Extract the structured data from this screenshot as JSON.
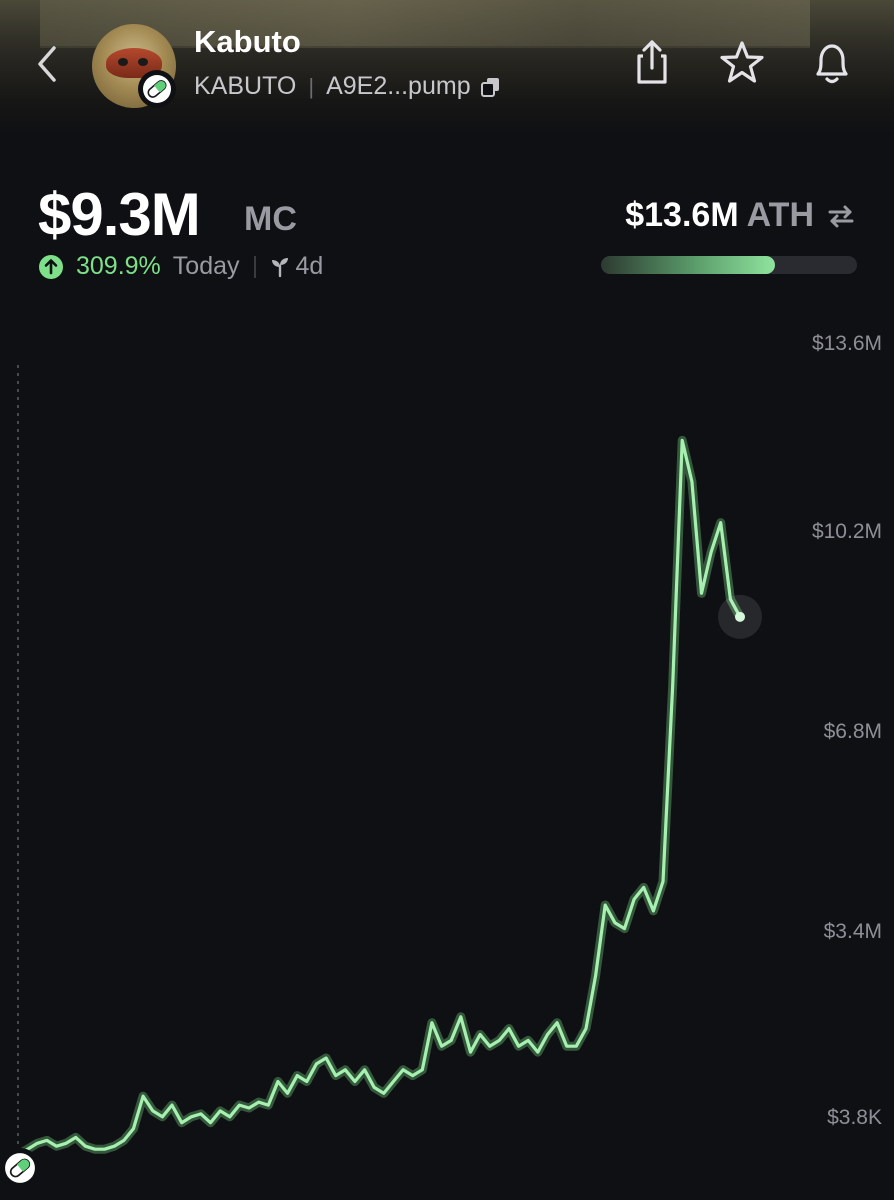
{
  "header": {
    "token_name": "Kabuto",
    "ticker": "KABUTO",
    "separator": "|",
    "address": "A9E2...pump",
    "icons": [
      "back-icon",
      "share-icon",
      "star-icon",
      "bell-icon",
      "copy-icon",
      "pill-icon"
    ]
  },
  "stats": {
    "market_cap": "$9.3M",
    "market_cap_unit": "MC",
    "change_pct": "309.9%",
    "change_period": "Today",
    "age": "4d",
    "ath_value": "$13.6M",
    "ath_label": "ATH",
    "ath_progress": 0.68
  },
  "colors": {
    "background": "#0f1014",
    "accent_green": "#7ee088",
    "muted_text": "#9a9aa2"
  },
  "chart_data": {
    "type": "line",
    "y_ticks": [
      "$13.6M",
      "$10.2M",
      "$6.8M",
      "$3.4M",
      "$3.8K"
    ],
    "ylim": [
      0,
      13.6
    ],
    "y_unit": "$M",
    "x": [
      0,
      1,
      2,
      3,
      4,
      5,
      6,
      7,
      8,
      9,
      10,
      11,
      12,
      13,
      14,
      15,
      16,
      17,
      18,
      19,
      20,
      21,
      22,
      23,
      24,
      25,
      26,
      27,
      28,
      29,
      30,
      31,
      32,
      33,
      34,
      35,
      36,
      37,
      38,
      39,
      40,
      41,
      42,
      43,
      44,
      45,
      46,
      47,
      48,
      49,
      50,
      51,
      52,
      53,
      54,
      55,
      56,
      57,
      58,
      59,
      60,
      61,
      62,
      63,
      64,
      65,
      66,
      67,
      68,
      69,
      70,
      71,
      72,
      73,
      74,
      75,
      76,
      77,
      78,
      79,
      80,
      81,
      82,
      83,
      84,
      85,
      86,
      87,
      88,
      89,
      90,
      91,
      92,
      93,
      94,
      95,
      96,
      97,
      98,
      99,
      100
    ],
    "values": [
      0.05,
      0.15,
      0.25,
      0.3,
      0.2,
      0.25,
      0.35,
      0.2,
      0.15,
      0.15,
      0.2,
      0.3,
      0.5,
      1.05,
      0.8,
      0.7,
      0.9,
      0.6,
      0.7,
      0.75,
      0.6,
      0.8,
      0.7,
      0.9,
      0.85,
      0.95,
      0.9,
      1.3,
      1.1,
      1.4,
      1.3,
      1.6,
      1.7,
      1.4,
      1.5,
      1.3,
      1.5,
      1.2,
      1.1,
      1.3,
      1.5,
      1.4,
      1.5,
      2.3,
      1.9,
      2.0,
      2.4,
      1.8,
      2.1,
      1.9,
      2.0,
      2.2,
      1.9,
      2.0,
      1.8,
      2.1,
      2.3,
      1.9,
      1.9,
      2.2,
      3.1,
      4.3,
      4.0,
      3.9,
      4.4,
      4.6,
      4.2,
      4.7,
      8.0,
      12.2,
      11.5,
      9.6,
      10.3,
      10.8,
      9.5,
      9.2
    ]
  }
}
